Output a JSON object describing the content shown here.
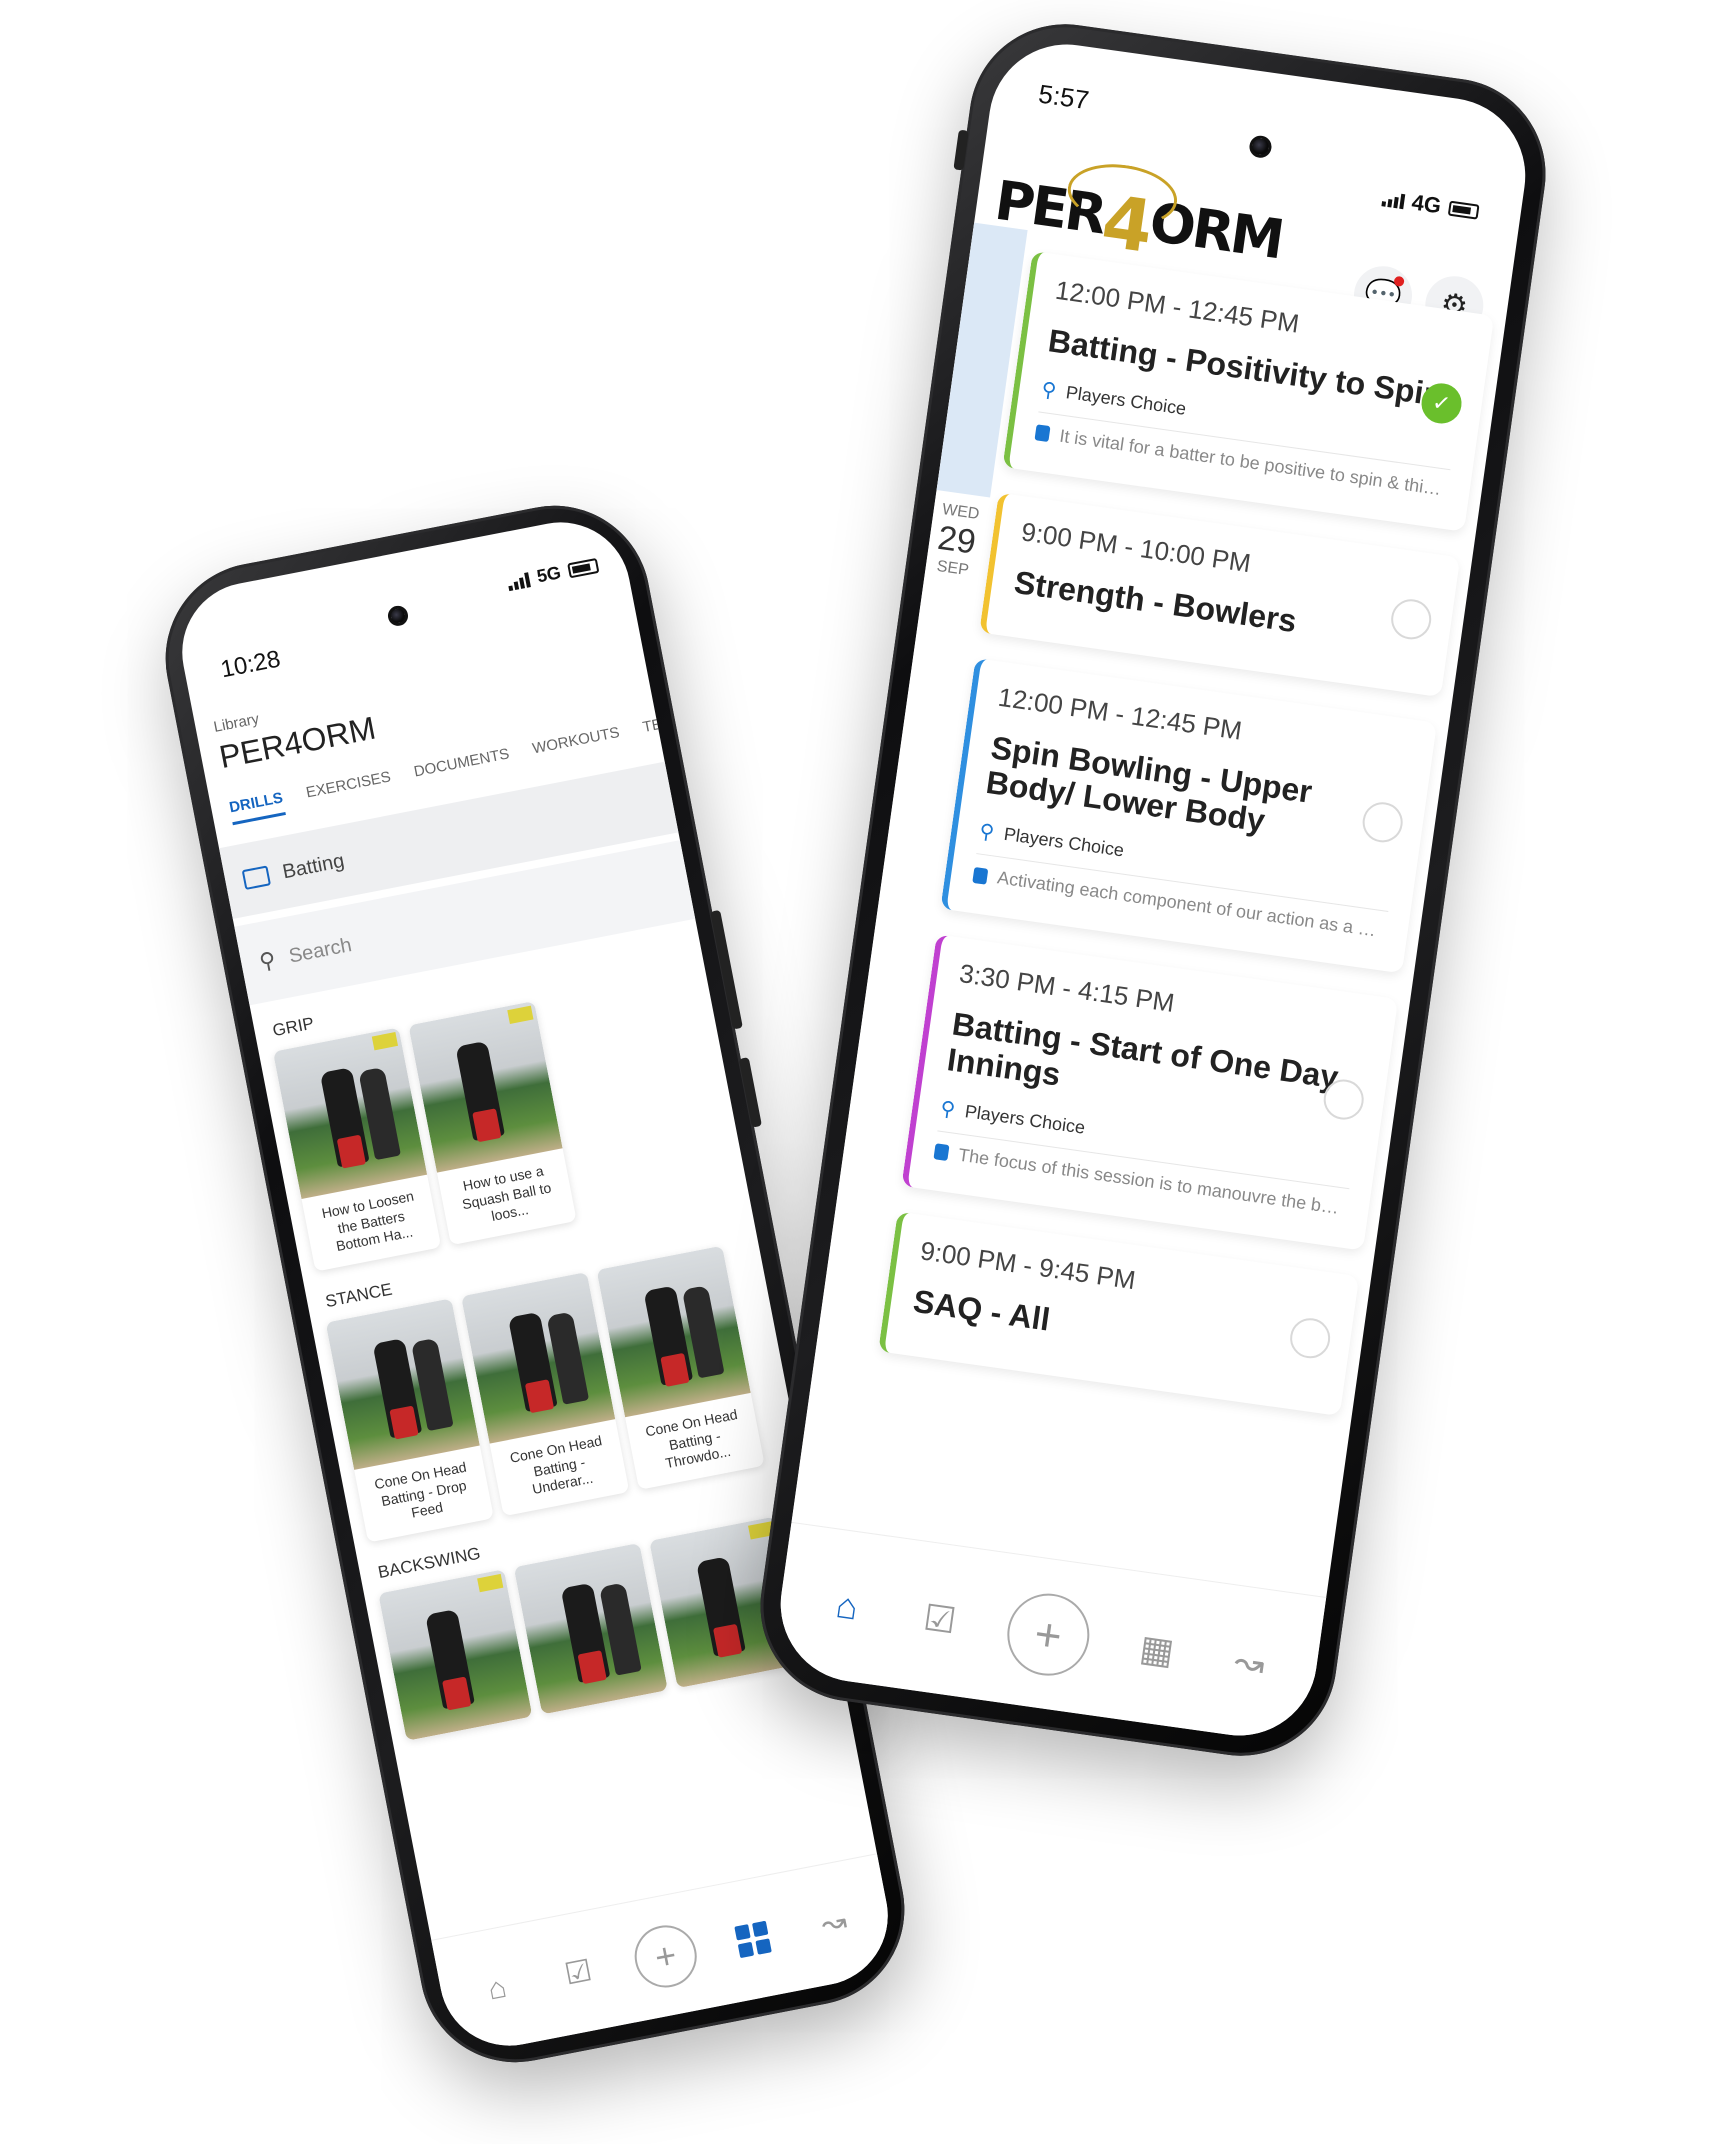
{
  "calendar_app": {
    "status": {
      "time": "5:57",
      "network": "4G"
    },
    "logo": {
      "prefix": "PER",
      "digit": "4",
      "suffix": "ORM"
    },
    "date": {
      "dow": "WED",
      "day": "29",
      "month": "SEP"
    },
    "events": [
      {
        "time": "12:00 PM - 12:45 PM",
        "title": "Batting - Positivity to Spin",
        "location": "Players Choice",
        "note": "It is vital for a batter to be positive to spin & this sessi...",
        "color": "#7bc043",
        "completed": true
      },
      {
        "time": "9:00 PM - 10:00 PM",
        "title": "Strength - Bowlers",
        "location": "",
        "note": "",
        "color": "#f2c230",
        "completed": false
      },
      {
        "time": "12:00 PM - 12:45 PM",
        "title": "Spin Bowling - Upper Body/ Lower Body",
        "location": "Players Choice",
        "note": "Activating each component of our action as a Spin Bo...",
        "color": "#2f8fe0",
        "completed": false
      },
      {
        "time": "3:30 PM - 4:15 PM",
        "title": "Batting - Start of One Day Innings",
        "location": "Players Choice",
        "note": "The focus of this session is to manouvre the ball to dif...",
        "color": "#c040d0",
        "completed": false
      },
      {
        "time": "9:00 PM - 9:45 PM",
        "title": "SAQ - All",
        "location": "",
        "note": "",
        "color": "#7bc043",
        "completed": false
      }
    ],
    "tabbar": {
      "home": "home-icon",
      "calendar": "calendar-check-icon",
      "add": "+",
      "library": "grid-icon",
      "analytics": "chart-line-icon",
      "active": "home"
    }
  },
  "library_app": {
    "status": {
      "time": "10:28",
      "network": "5G"
    },
    "header": {
      "small": "Library",
      "title": "PER4ORM"
    },
    "tabs": [
      {
        "label": "DRILLS",
        "active": true
      },
      {
        "label": "EXERCISES",
        "active": false
      },
      {
        "label": "DOCUMENTS",
        "active": false
      },
      {
        "label": "WORKOUTS",
        "active": false
      },
      {
        "label": "TEAM PRAC",
        "active": false
      }
    ],
    "folder": "Batting",
    "search": {
      "placeholder": "Search"
    },
    "sections": [
      {
        "label": "GRIP",
        "cards": [
          {
            "caption": "How to Loosen the Batters Bottom Ha..."
          },
          {
            "caption": "How to use a Squash Ball to loos..."
          }
        ]
      },
      {
        "label": "STANCE",
        "cards": [
          {
            "caption": "Cone On Head Batting - Drop Feed"
          },
          {
            "caption": "Cone On Head Batting - Underar..."
          },
          {
            "caption": "Cone On Head Batting - Throwdo..."
          }
        ]
      },
      {
        "label": "BACKSWING",
        "cards": [
          {
            "caption": ""
          },
          {
            "caption": ""
          },
          {
            "caption": ""
          }
        ]
      }
    ],
    "tabbar": {
      "active": "library"
    }
  }
}
